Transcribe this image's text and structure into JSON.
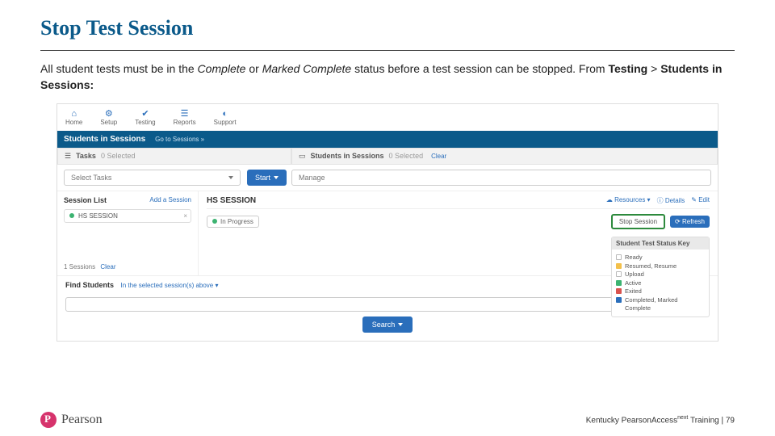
{
  "title": "Stop Test Session",
  "body_pre": "All student tests must be in the ",
  "body_complete": "Complete",
  "body_or": " or ",
  "body_marked": "Marked Complete",
  "body_mid": " status before a test session can be stopped. From ",
  "body_testing": "Testing",
  "body_gt": " > ",
  "body_sis": "Students in Sessions:",
  "nav": {
    "home": "Home",
    "setup": "Setup",
    "testing": "Testing",
    "reports": "Reports",
    "support": "Support"
  },
  "bluebar": {
    "title": "Students in Sessions",
    "go": "Go to Sessions »"
  },
  "tasks": {
    "label": "Tasks",
    "count": "0 Selected",
    "select": "Select Tasks",
    "start": "Start"
  },
  "sis": {
    "label": "Students in Sessions",
    "count": "0 Selected",
    "clear": "Clear",
    "manage": "Manage"
  },
  "sesslist": {
    "title": "Session List",
    "add": "Add a Session",
    "item": "HS SESSION",
    "count": "1 Sessions",
    "clear": "Clear"
  },
  "sessmain": {
    "name": "HS SESSION",
    "resources": "Resources",
    "details": "Details",
    "edit": "Edit",
    "status": "In Progress",
    "stop": "Stop Session",
    "refresh": "Refresh"
  },
  "key": {
    "title": "Student Test Status Key",
    "items": [
      {
        "color": "#ffffff",
        "border": "#bbb",
        "label": "Ready"
      },
      {
        "color": "#f3c04b",
        "label": "Resumed, Resume"
      },
      {
        "color": "#ffffff",
        "border": "#bbb",
        "label": "Upload"
      },
      {
        "color": "#3cb371",
        "label": "Active"
      },
      {
        "color": "#d9534f",
        "label": "Exited"
      },
      {
        "color": "#2a6ebb",
        "label": "Completed, Marked"
      },
      {
        "color": "transparent",
        "label": "Complete"
      }
    ]
  },
  "find": {
    "label": "Find Students",
    "in": "In the selected session(s) above",
    "search": "Search"
  },
  "footer": {
    "text_pre": "Kentucky PearsonAccess",
    "text_post": " Training",
    "sep": " | ",
    "page": "79",
    "sup": "next"
  },
  "logo": "Pearson"
}
